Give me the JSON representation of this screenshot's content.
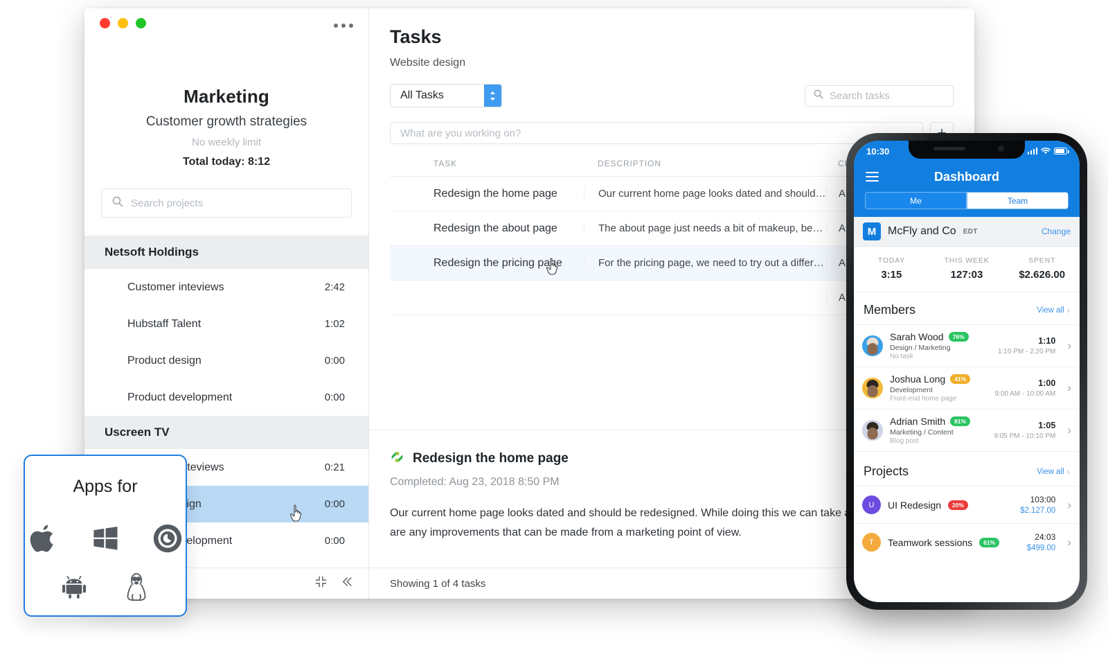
{
  "desktop": {
    "sidebar": {
      "window_controls": [
        "close",
        "minimize",
        "maximize"
      ],
      "menu_icon": "kebab-menu-icon",
      "project_title": "Marketing",
      "project_subtitle": "Customer growth strategies",
      "weekly_limit": "No weekly limit",
      "total_today": "Total today: 8:12",
      "search_placeholder": "Search projects",
      "groups": [
        {
          "name": "Netsoft Holdings",
          "items": [
            {
              "label": "Customer inteviews",
              "time": "2:42",
              "selected": false
            },
            {
              "label": "Hubstaff Talent",
              "time": "1:02",
              "selected": false
            },
            {
              "label": "Product design",
              "time": "0:00",
              "selected": false
            },
            {
              "label": "Product development",
              "time": "0:00",
              "selected": false
            }
          ]
        },
        {
          "name": "Uscreen TV",
          "items": [
            {
              "label": "Customer inteviews",
              "time": "0:21",
              "selected": false
            },
            {
              "label": "Product design",
              "time": "0:00",
              "selected": true
            },
            {
              "label": "Product development",
              "time": "0:00",
              "selected": false
            }
          ]
        }
      ],
      "footer_icons": [
        "compress-icon",
        "collapse-left-icon"
      ]
    },
    "main": {
      "title": "Tasks",
      "subtitle": "Website design",
      "filter_value": "All Tasks",
      "search_placeholder": "Search tasks",
      "add_task_placeholder": "What are you working on?",
      "add_button_label": "+",
      "columns": [
        "TASK",
        "DESCRIPTION",
        "CREATED"
      ],
      "rows": [
        {
          "task": "Redesign the home page",
          "description": "Our current home page looks dated and should…",
          "created": "A…",
          "active": false,
          "running": false
        },
        {
          "task": "Redesign the about page",
          "description": "The about page just needs a bit of makeup, bec…",
          "created": "A…",
          "active": false,
          "running": false
        },
        {
          "task": "Redesign the pricing page",
          "description": "For the pricing page, we need to try out a differe…",
          "created": "A…",
          "active": true,
          "running": true
        },
        {
          "task": "",
          "description": "",
          "created": "A…",
          "active": false,
          "running": false
        }
      ],
      "detail": {
        "icon": "hubstaff-logo-icon",
        "title": "Redesign the home page",
        "completed": "Completed: Aug 23, 2018 8:50 PM",
        "body": "Our current home page looks dated and should be redesigned. While doing this we can take a look and see if there are any improvements that can be made from a marketing point of view."
      },
      "footer_status": "Showing 1 of 4 tasks"
    }
  },
  "apps_card": {
    "title": "Apps for",
    "platforms": [
      {
        "name": "apple-icon"
      },
      {
        "name": "windows-icon"
      },
      {
        "name": "chrome-icon"
      },
      {
        "name": "android-icon"
      },
      {
        "name": "linux-icon"
      }
    ]
  },
  "phone": {
    "status": {
      "time": "10:30",
      "icons": [
        "signal-icon",
        "wifi-icon",
        "battery-icon"
      ]
    },
    "nav": {
      "menu_icon": "hamburger-icon",
      "title": "Dashboard"
    },
    "tabs": [
      {
        "label": "Me",
        "active": true
      },
      {
        "label": "Team",
        "active": false
      }
    ],
    "org": {
      "initial": "M",
      "name": "McFly and Co",
      "timezone": "EDT",
      "change_label": "Change"
    },
    "stats": [
      {
        "label": "TODAY",
        "value": "3:15"
      },
      {
        "label": "THIS WEEK",
        "value": "127:03"
      },
      {
        "label": "SPENT",
        "value": "$2.626.00"
      }
    ],
    "members_section": {
      "title": "Members",
      "view_all": "View all"
    },
    "members": [
      {
        "name": "Sarah Wood",
        "percent": "76%",
        "percent_color": "#2bc463",
        "role": "Design / Marketing",
        "task": "No task",
        "duration": "1:10",
        "range": "1:10 PM - 2:20 PM",
        "avatar_bg": "#3aa0ea",
        "hair": "#e7ddd0"
      },
      {
        "name": "Joshua Long",
        "percent": "41%",
        "percent_color": "#f0ae2a",
        "role": "Development",
        "task": "Front-end home page",
        "duration": "1:00",
        "range": "9:00 AM - 10:00 AM",
        "avatar_bg": "#f2b93b",
        "hair": "#2e2722"
      },
      {
        "name": "Adrian Smith",
        "percent": "81%",
        "percent_color": "#2bc463",
        "role": "Marketing / Content",
        "task": "Blog post",
        "duration": "1:05",
        "range": "9:05 PM - 10:10 PM",
        "avatar_bg": "#cfd4e6",
        "hair": "#30281f"
      }
    ],
    "projects_section": {
      "title": "Projects",
      "view_all": "View all"
    },
    "projects": [
      {
        "initial": "U",
        "name": "UI Redesign",
        "percent": "20%",
        "percent_color": "#ec3b3b",
        "circle_color": "#6c4ce0",
        "hours": "103:00",
        "money": "$2.127.00"
      },
      {
        "initial": "T",
        "name": "Teamwork sessions",
        "percent": "61%",
        "percent_color": "#2bc463",
        "circle_color": "#f2ab3c",
        "hours": "24:03",
        "money": "$499.00"
      }
    ]
  },
  "colors": {
    "accent": "#127ee0",
    "selected_row": "#b9d9f5",
    "group_header": "#ebedef"
  }
}
